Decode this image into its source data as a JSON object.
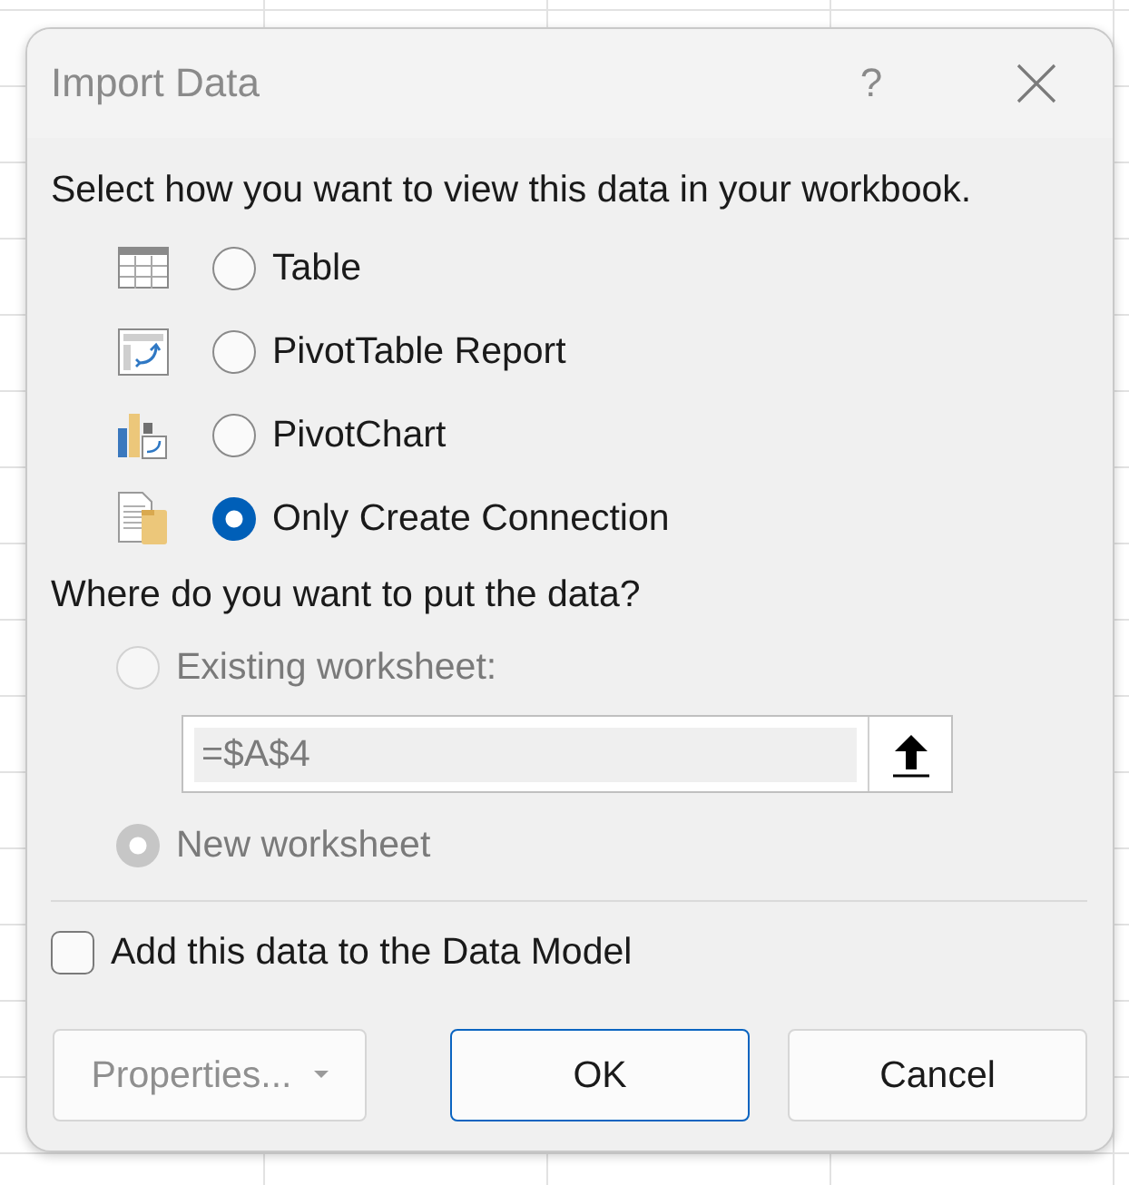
{
  "window": {
    "title": "Import Data",
    "help": "?"
  },
  "view_prompt": "Select how you want to view this data in your workbook.",
  "view_options": [
    {
      "kind": "table",
      "label": "Table",
      "selected": false
    },
    {
      "kind": "pivot_table",
      "label": "PivotTable Report",
      "selected": false
    },
    {
      "kind": "pivot_chart",
      "label": "PivotChart",
      "selected": false
    },
    {
      "kind": "connection",
      "label": "Only Create Connection",
      "selected": true
    }
  ],
  "location_prompt": "Where do you want to put the data?",
  "location_options": [
    {
      "label": "Existing worksheet:",
      "selected": false,
      "disabled": true
    },
    {
      "label": "New worksheet",
      "selected": true,
      "disabled": true
    }
  ],
  "range_field": {
    "value": "=$A$4",
    "disabled": true
  },
  "data_model": {
    "label": "Add this data to the Data Model",
    "checked": false
  },
  "buttons": [
    {
      "kind": "split",
      "label": "Properties...",
      "disabled": true,
      "default": false
    },
    {
      "kind": "plain",
      "label": "OK",
      "disabled": false,
      "default": true
    },
    {
      "kind": "plain",
      "label": "Cancel",
      "disabled": false,
      "default": false
    }
  ]
}
